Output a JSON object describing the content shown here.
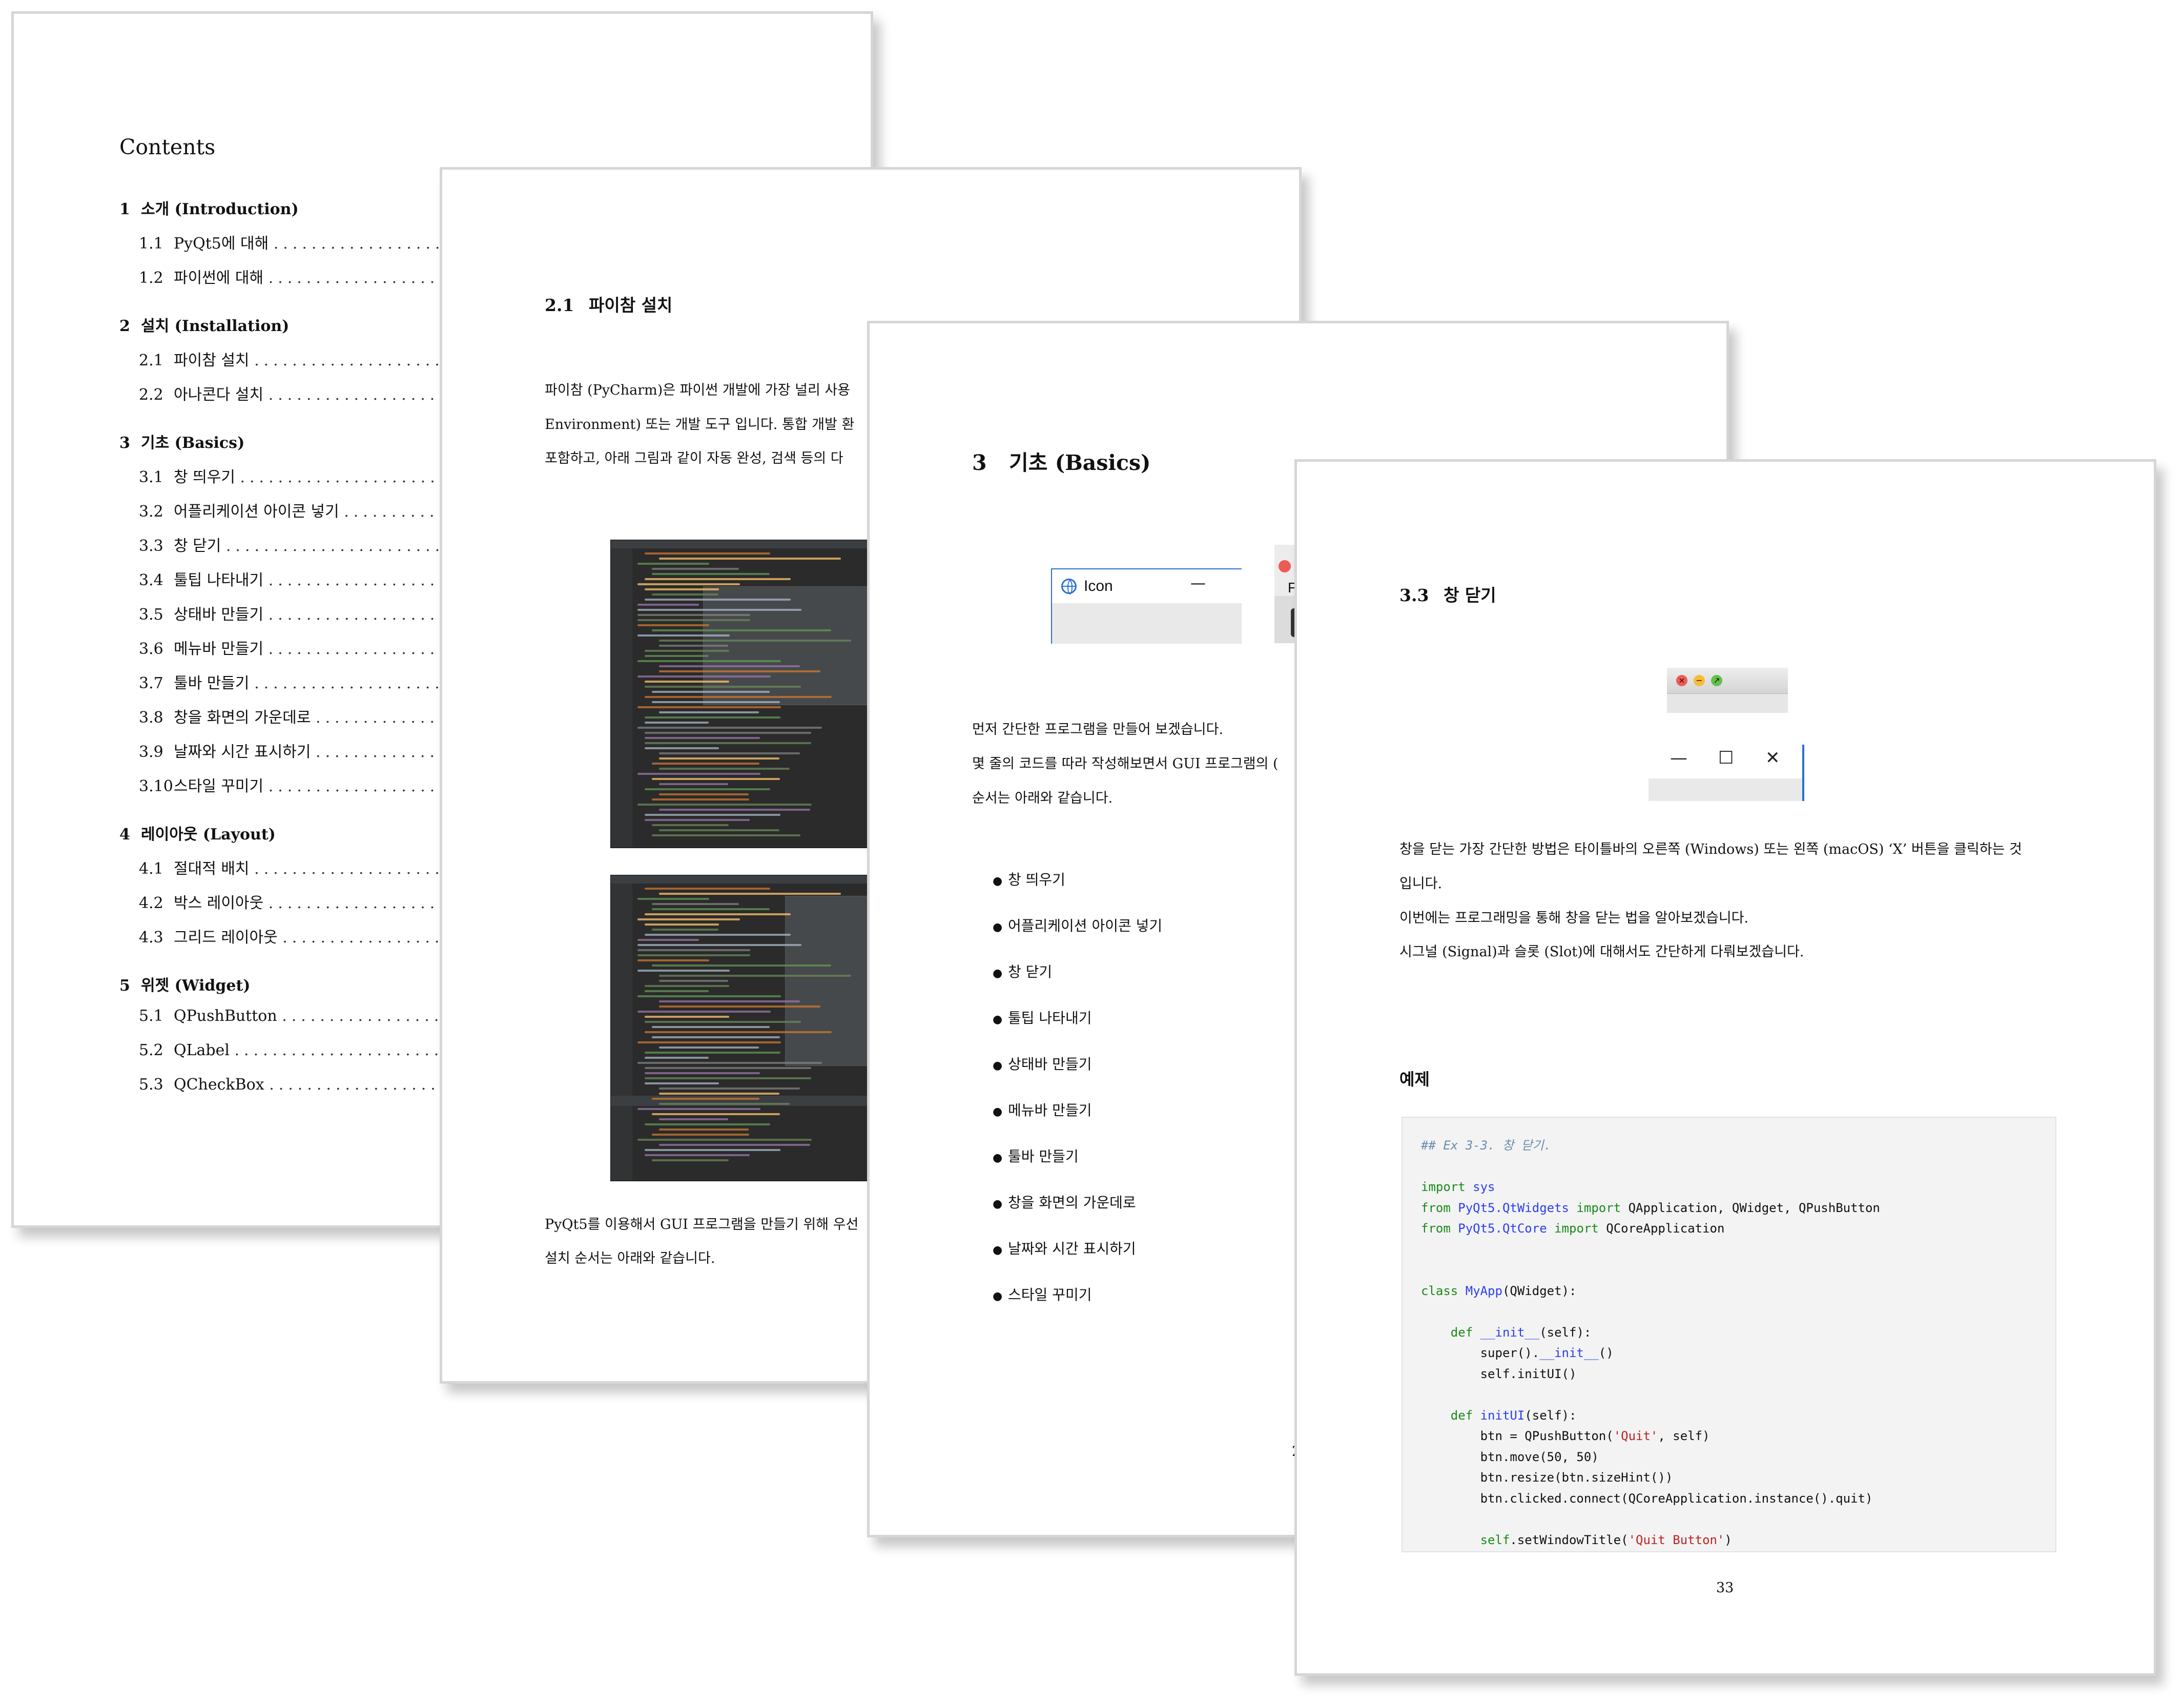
{
  "contents_page": {
    "title": "Contents",
    "chapters": [
      {
        "num": "1",
        "title": "소개 (Introduction)",
        "sections": [
          {
            "num": "1.1",
            "title": "PyQt5에 대해"
          },
          {
            "num": "1.2",
            "title": "파이썬에 대해"
          }
        ]
      },
      {
        "num": "2",
        "title": "설치 (Installation)",
        "sections": [
          {
            "num": "2.1",
            "title": "파이참 설치"
          },
          {
            "num": "2.2",
            "title": "아나콘다 설치"
          }
        ]
      },
      {
        "num": "3",
        "title": "기초 (Basics)",
        "sections": [
          {
            "num": "3.1",
            "title": "창 띄우기"
          },
          {
            "num": "3.2",
            "title": "어플리케이션 아이콘 넣기"
          },
          {
            "num": "3.3",
            "title": "창 닫기"
          },
          {
            "num": "3.4",
            "title": "툴팁 나타내기"
          },
          {
            "num": "3.5",
            "title": "상태바 만들기"
          },
          {
            "num": "3.6",
            "title": "메뉴바 만들기"
          },
          {
            "num": "3.7",
            "title": "툴바 만들기"
          },
          {
            "num": "3.8",
            "title": "창을 화면의 가운데로"
          },
          {
            "num": "3.9",
            "title": "날짜와 시간 표시하기"
          },
          {
            "num": "3.10",
            "title": "스타일 꾸미기"
          }
        ]
      },
      {
        "num": "4",
        "title": "레이아웃 (Layout)",
        "sections": [
          {
            "num": "4.1",
            "title": "절대적 배치"
          },
          {
            "num": "4.2",
            "title": "박스 레이아웃"
          },
          {
            "num": "4.3",
            "title": "그리드 레이아웃"
          }
        ]
      },
      {
        "num": "5",
        "title": "위젯 (Widget)",
        "sections": [
          {
            "num": "5.1",
            "title": "QPushButton"
          },
          {
            "num": "5.2",
            "title": "QLabel"
          },
          {
            "num": "5.3",
            "title": "QCheckBox"
          }
        ]
      }
    ]
  },
  "pycharm_page": {
    "section_num": "2.1",
    "section_title": "파이참 설치",
    "intro_lines": [
      "파이참 (PyCharm)은 파이썬 개발에 가장 널리 사용",
      "Environment) 또는 개발 도구 입니다. 통합 개발 환",
      "포함하고, 아래 그림과 같이 자동 완성, 검색 등의 다"
    ],
    "outro_lines": [
      "PyQt5를 이용해서 GUI 프로그램을 만들기 위해 우선",
      "설치 순서는 아래와 같습니다."
    ]
  },
  "basics_page": {
    "chapter_num": "3",
    "chapter_title": "기초 (Basics)",
    "window_title": "Icon",
    "window_min": "—",
    "partial_window_letter": "F",
    "intro_lines": [
      "먼저 간단한 프로그램을 만들어 보겠습니다.",
      "몇 줄의 코드를 따라 작성해보면서 GUI 프로그램의 (",
      "순서는 아래와 같습니다."
    ],
    "bullets": [
      "창 띄우기",
      "어플리케이션 아이콘 넣기",
      "창 닫기",
      "툴팁 나타내기",
      "상태바 만들기",
      "메뉴바 만들기",
      "툴바 만들기",
      "창을 화면의 가운데로",
      "날짜와 시간 표시하기",
      "스타일 꾸미기"
    ],
    "page_num_fragment": "2"
  },
  "close_page": {
    "section_num": "3.3",
    "section_title": "창 닫기",
    "win_min": "—",
    "win_max": "☐",
    "win_close": "✕",
    "body_lines": [
      "창을 닫는 가장 간단한 방법은 타이틀바의 오른쪽 (Windows) 또는 왼쪽 (macOS) ‘X’ 버튼을 클릭하는 것",
      "입니다.",
      "이번에는 프로그래밍을 통해 창을 닫는 법을 알아보겠습니다.",
      "시그널 (Signal)과 슬롯 (Slot)에 대해서도 간단하게 다뤄보겠습니다."
    ],
    "example_heading": "예제",
    "code": {
      "comment": "## Ex 3-3. 창 닫기.",
      "kw_import": "import",
      "kw_from": "from",
      "kw_class": "class",
      "kw_def": "def",
      "kw_self": "self",
      "sys": "sys",
      "qtwidgets": "PyQt5.QtWidgets",
      "qtwidgets_names": "QApplication, QWidget, QPushButton",
      "qtcore": "PyQt5.QtCore",
      "qtcore_names": "QCoreApplication",
      "class_name": "MyApp",
      "class_base": "(QWidget):",
      "init_name": "__init__",
      "init_args": "(self):",
      "super_prefix": "super().",
      "super_suffix": "()",
      "self_initui": "self.initUI()",
      "initui_name": "initUI",
      "btn_pre": "btn = QPushButton(",
      "btn_str": "'Quit'",
      "btn_post": ", self)",
      "line_move": "btn.move(50, 50)",
      "line_resize": "btn.resize(btn.sizeHint())",
      "line_connect": "btn.clicked.connect(QCoreApplication.instance().quit)",
      "title_pre": ".setWindowTitle(",
      "title_str": "'Quit Button'",
      "title_post": ")"
    },
    "page_number": "33"
  }
}
